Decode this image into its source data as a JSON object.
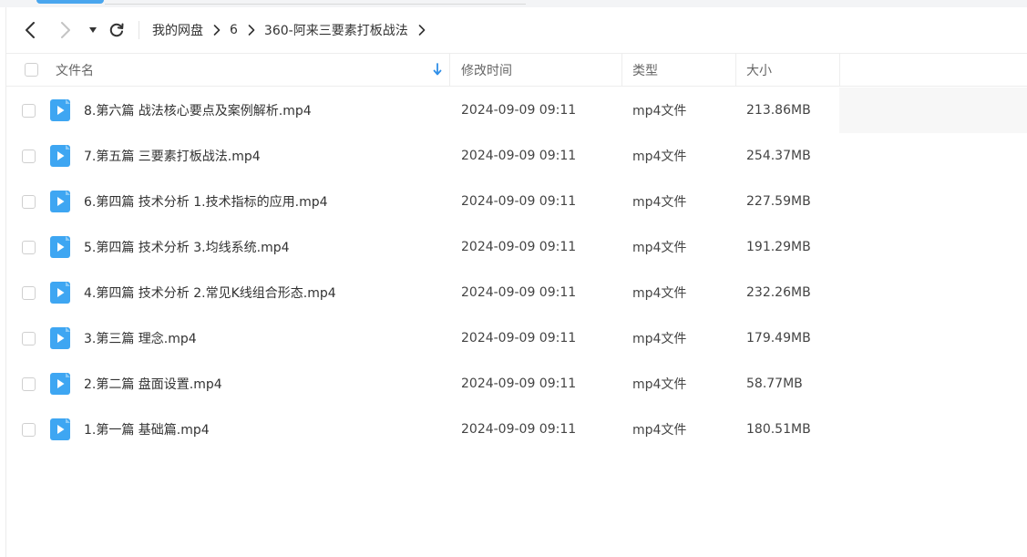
{
  "breadcrumb": {
    "items": [
      "我的网盘",
      "6",
      "360-阿来三要素打板战法"
    ]
  },
  "columns": {
    "name": "文件名",
    "mtime": "修改时间",
    "type": "类型",
    "size": "大小"
  },
  "files": [
    {
      "name": "8.第六篇 战法核心要点及案例解析.mp4",
      "mtime": "2024-09-09 09:11",
      "type": "mp4文件",
      "size": "213.86MB"
    },
    {
      "name": "7.第五篇 三要素打板战法.mp4",
      "mtime": "2024-09-09 09:11",
      "type": "mp4文件",
      "size": "254.37MB"
    },
    {
      "name": "6.第四篇 技术分析 1.技术指标的应用.mp4",
      "mtime": "2024-09-09 09:11",
      "type": "mp4文件",
      "size": "227.59MB"
    },
    {
      "name": "5.第四篇 技术分析 3.均线系统.mp4",
      "mtime": "2024-09-09 09:11",
      "type": "mp4文件",
      "size": "191.29MB"
    },
    {
      "name": "4.第四篇 技术分析 2.常见K线组合形态.mp4",
      "mtime": "2024-09-09 09:11",
      "type": "mp4文件",
      "size": "232.26MB"
    },
    {
      "name": "3.第三篇 理念.mp4",
      "mtime": "2024-09-09 09:11",
      "type": "mp4文件",
      "size": "179.49MB"
    },
    {
      "name": "2.第二篇 盘面设置.mp4",
      "mtime": "2024-09-09 09:11",
      "type": "mp4文件",
      "size": "58.77MB"
    },
    {
      "name": "1.第一篇 基础篇.mp4",
      "mtime": "2024-09-09 09:11",
      "type": "mp4文件",
      "size": "180.51MB"
    }
  ],
  "icons": {
    "video_file": "video-file-icon",
    "back": "chevron-left-icon",
    "forward": "chevron-right-icon",
    "dropdown": "caret-down-icon",
    "refresh": "refresh-icon",
    "sort": "sort-down-arrow-icon"
  },
  "colors": {
    "accent": "#4aa6ee",
    "file_icon": "#3ea6f2"
  }
}
